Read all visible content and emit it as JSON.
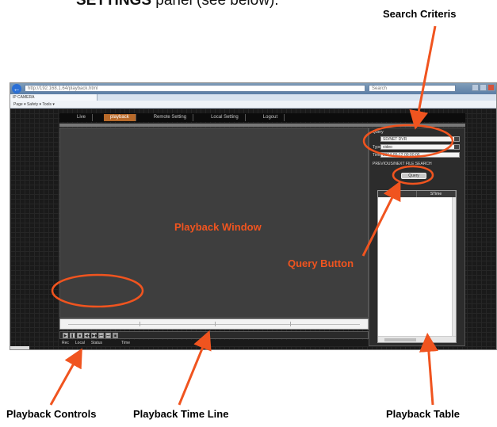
{
  "intro": {
    "bold": "SETTINGS",
    "rest": " panel (see below)."
  },
  "browser": {
    "address": "http://192.168.1.64/playback.html",
    "search": "Search",
    "tab": "IP CAMERA",
    "command_bar": "Page ▾  Safety ▾  Tools ▾"
  },
  "nav": {
    "items": [
      {
        "label": "Live",
        "active": false
      },
      {
        "label": "playback",
        "active": true
      },
      {
        "label": "Remote Setting",
        "active": false
      },
      {
        "label": "Local Setting",
        "active": false
      },
      {
        "label": "Logout",
        "active": false
      }
    ]
  },
  "criteria": {
    "heading": "Query",
    "fields": [
      {
        "label": "",
        "value": "SD/NET DVR"
      },
      {
        "label": "Type",
        "value": "video"
      },
      {
        "label": "Time",
        "value": "2014-05-12 00:00:00"
      }
    ],
    "option": "PREVIOUS/NEXT FILE SEARCH",
    "query_label": "Query"
  },
  "table": {
    "col_num": "No.",
    "col_time": "STime"
  },
  "controls": {
    "buttons": [
      "▶",
      "❚❚",
      "■",
      "◀◀",
      "▶▶",
      "⏮",
      "⏭",
      "▣"
    ]
  },
  "status": {
    "rec": "Rec",
    "local": "Local",
    "status": "Status",
    "time": "Time"
  },
  "annotations": {
    "search_criteria": "Search Criteris",
    "playback_window": "Playback Window",
    "query_button": "Query Button",
    "playback_controls": "Playback Controls",
    "playback_time_line": "Playback Time Line",
    "playback_table": "Playback Table"
  },
  "colors": {
    "annotation": "#f0541f",
    "active_tab": "#b86a2a"
  }
}
